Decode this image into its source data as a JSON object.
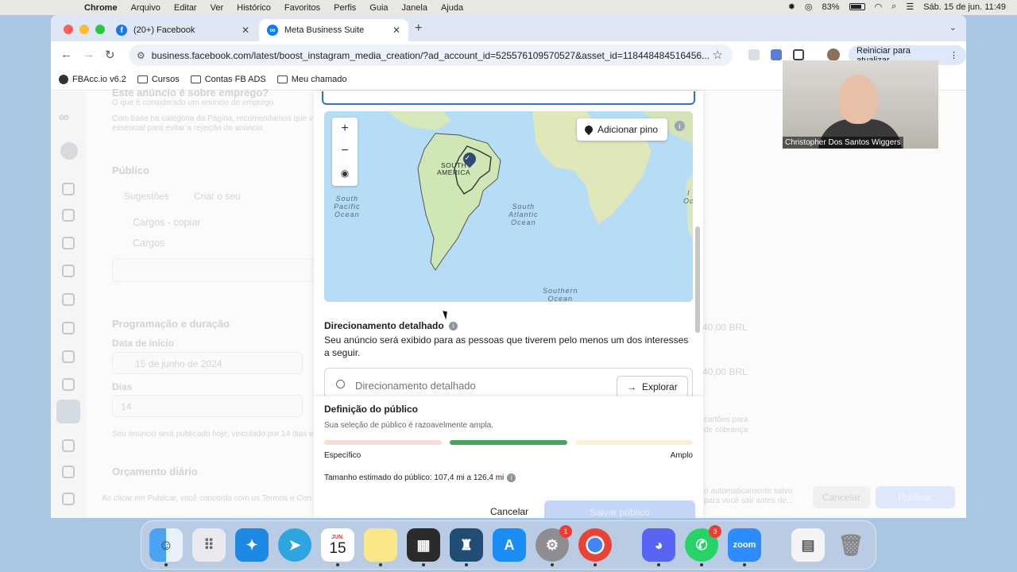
{
  "menubar": {
    "app": "Chrome",
    "items": [
      "Arquivo",
      "Editar",
      "Ver",
      "Histórico",
      "Favoritos",
      "Perfis",
      "Guia",
      "Janela",
      "Ajuda"
    ],
    "battery": "83%",
    "datetime": "Sáb. 15 de jun.  11:49"
  },
  "tabs": [
    {
      "title": "(20+) Facebook"
    },
    {
      "title": "Meta Business Suite"
    }
  ],
  "toolbar": {
    "url": "business.facebook.com/latest/boost_instagram_media_creation/?ad_account_id=525576109570527&asset_id=118448484516456...",
    "restart_label": "Reiniciar para atualizar"
  },
  "bookmarks": [
    "FBAcc.io v6.2",
    "Cursos",
    "Contas FB ADS",
    "Meu chamado"
  ],
  "background": {
    "employment_title": "Este anúncio é sobre emprego?",
    "employment_sub": "O que é considerado um anúncio de emprego",
    "employment_desc1": "Com base na categoria da Página, recomendamos que v",
    "employment_desc2": "essencial para evitar a rejeição do anúncio",
    "publico_title": "Público",
    "tab_suggestions": "Sugestões",
    "tab_create": "Criar o seu",
    "audience1": "Cargos - copiar",
    "audience2": "Cargos",
    "schedule_title": "Programação e duração",
    "start_label": "Data de início",
    "start_value": "15 de junho de 2024",
    "days_label": "Dias",
    "days_value": "14",
    "schedule_note": "Seu anúncio será publicado hoje, veiculado por 14 dias e",
    "budget_title": "Orçamento diário",
    "terms_note": "Ao clicar em Publicar, você concorda com os Termos e Con",
    "price1": "40,00 BRL",
    "price2": "40,00 BRL",
    "right_note1": "cartões para",
    "right_note2": "de cobrança",
    "right_note3": "o automaticamente salvo",
    "right_note4": "para você sair antes de...",
    "cancel": "Cancelar",
    "publish": "Publicar"
  },
  "map": {
    "add_pin": "Adicionar pino",
    "continent": "SOUTH\nAMERICA",
    "ocean1": "South\nPacific\nOcean",
    "ocean2": "South\nAtlantic\nOcean",
    "ocean3": "Southern\nOcean",
    "ocean4": "I\nOc"
  },
  "detailed": {
    "title": "Direcionamento detalhado",
    "desc": "Seu anúncio será exibido para as pessoas que tiverem pelo menos um dos interesses a seguir.",
    "placeholder": "Direcionamento detalhado",
    "explore": "Explorar"
  },
  "audience": {
    "title": "Definição do público",
    "desc": "Sua seleção de público é razoavelmente ampla.",
    "low": "Específico",
    "high": "Amplo",
    "size": "Tamanho estimado do público: 107,4 mi a 126,4 mi",
    "meter_level": "middle",
    "cancel": "Cancelar",
    "save": "Salvar público"
  },
  "video": {
    "name": "Christopher Dos Santos Wiggers"
  },
  "dock": {
    "calendar_month": "JUN.",
    "calendar_day": "15",
    "settings_badge": "1",
    "whatsapp_badge": "3",
    "zoom_label": "zoom"
  }
}
